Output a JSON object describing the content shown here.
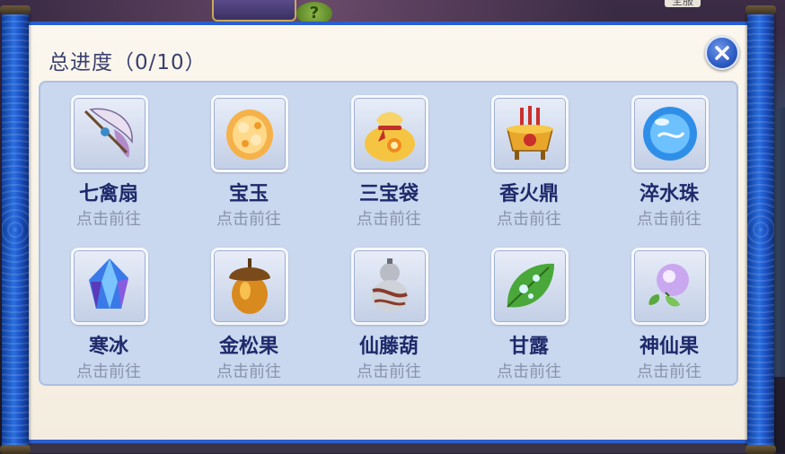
{
  "header": {
    "title": "总进度（0/10）",
    "close_icon": "close-icon"
  },
  "background": {
    "corner_label": "全服",
    "help_icon": "?"
  },
  "items": [
    {
      "name": "七禽扇",
      "action": "点击前往",
      "icon": "feather-fan-icon"
    },
    {
      "name": "宝玉",
      "action": "点击前往",
      "icon": "jade-icon"
    },
    {
      "name": "三宝袋",
      "action": "点击前往",
      "icon": "treasure-bag-icon"
    },
    {
      "name": "香火鼎",
      "action": "点击前往",
      "icon": "incense-cauldron-icon"
    },
    {
      "name": "淬水珠",
      "action": "点击前往",
      "icon": "water-orb-icon"
    },
    {
      "name": "寒冰",
      "action": "点击前往",
      "icon": "ice-crystal-icon"
    },
    {
      "name": "金松果",
      "action": "点击前往",
      "icon": "acorn-icon"
    },
    {
      "name": "仙藤葫",
      "action": "点击前往",
      "icon": "gourd-icon"
    },
    {
      "name": "甘露",
      "action": "点击前往",
      "icon": "leaf-dew-icon"
    },
    {
      "name": "神仙果",
      "action": "点击前往",
      "icon": "fairy-fruit-icon"
    }
  ],
  "colors": {
    "roller": "#1b50c0",
    "title": "#3a3f6e",
    "item_name": "#1e2a6a",
    "item_link": "#8a93ac",
    "panel": "#c9d7ef"
  }
}
